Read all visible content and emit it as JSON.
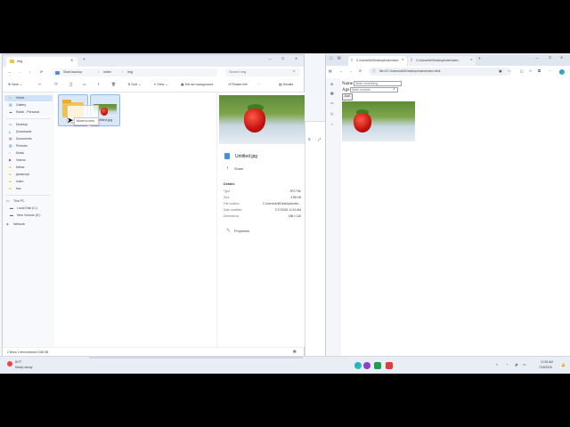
{
  "explorer": {
    "tab_title": "img",
    "breadcrumb": [
      "Start backup",
      "index",
      "img"
    ],
    "search_placeholder": "Search img",
    "toolbar": {
      "new": "New",
      "sort": "Sort",
      "view": "View",
      "set_background": "Set as background",
      "rotate_left": "Rotate left",
      "details": "Details"
    },
    "nav": [
      {
        "label": "Home",
        "icon": "home-icon",
        "selected": true
      },
      {
        "label": "Gallery",
        "icon": "gallery-icon"
      },
      {
        "label": "Rahib - Personal",
        "icon": "cloud-icon"
      },
      {
        "label": "Desktop",
        "icon": "desktop-icon"
      },
      {
        "label": "Downloads",
        "icon": "download-icon"
      },
      {
        "label": "Documents",
        "icon": "document-icon"
      },
      {
        "label": "Pictures",
        "icon": "pictures-icon"
      },
      {
        "label": "Music",
        "icon": "music-icon"
      },
      {
        "label": "Videos",
        "icon": "video-icon"
      },
      {
        "label": "Mdow",
        "icon": "folder-icon"
      },
      {
        "label": "javascript",
        "icon": "folder-icon"
      },
      {
        "label": "index",
        "icon": "folder-icon"
      },
      {
        "label": "bss",
        "icon": "folder-icon"
      },
      {
        "label": "This PC",
        "icon": "pc-icon"
      },
      {
        "label": "Local Disk (C:)",
        "icon": "disk-icon"
      },
      {
        "label": "New Volume (D:)",
        "icon": "disk-icon"
      },
      {
        "label": "Network",
        "icon": "network-icon"
      }
    ],
    "files": [
      {
        "name": "",
        "type": "folder"
      },
      {
        "name": "Untitled.jpg",
        "type": "image"
      }
    ],
    "drag_tooltip": "Move to new",
    "details_pane": {
      "file_name": "Untitled.jpg",
      "share": "Share",
      "section": "Details",
      "rows": [
        {
          "k": "Type",
          "v": "JPG File"
        },
        {
          "k": "Size",
          "v": "3.88 KB"
        },
        {
          "k": "File location",
          "v": "C:\\Users\\Arif\\Desktop\\index..."
        },
        {
          "k": "Date modified",
          "v": "7/17/2026 12:43 AM"
        },
        {
          "k": "Dimensions",
          "v": "186 x 116"
        }
      ],
      "properties": "Properties"
    },
    "status": "2 items    1 item selected  3.88 KB"
  },
  "browser": {
    "tab1": "C:/Users/Arif/Desktop/index/index",
    "tab2": "C:/Users/Arif/Desktop/index/index.",
    "url": "file:///C:/Users/Arif/Desktop/index/index.html",
    "form": {
      "name_label": "Name",
      "name_placeholder": "Write something",
      "age_label": "Age",
      "age_placeholder": "Write number",
      "button": "Add"
    }
  },
  "taskbar": {
    "weather_temp": "81°F",
    "weather_desc": "Mostly cloudy",
    "time": "12:53 AM",
    "date": "7/18/2026"
  },
  "colors": {
    "accent": "#0067c0",
    "folder": "#f5c14b",
    "berry": "#d1150f"
  }
}
